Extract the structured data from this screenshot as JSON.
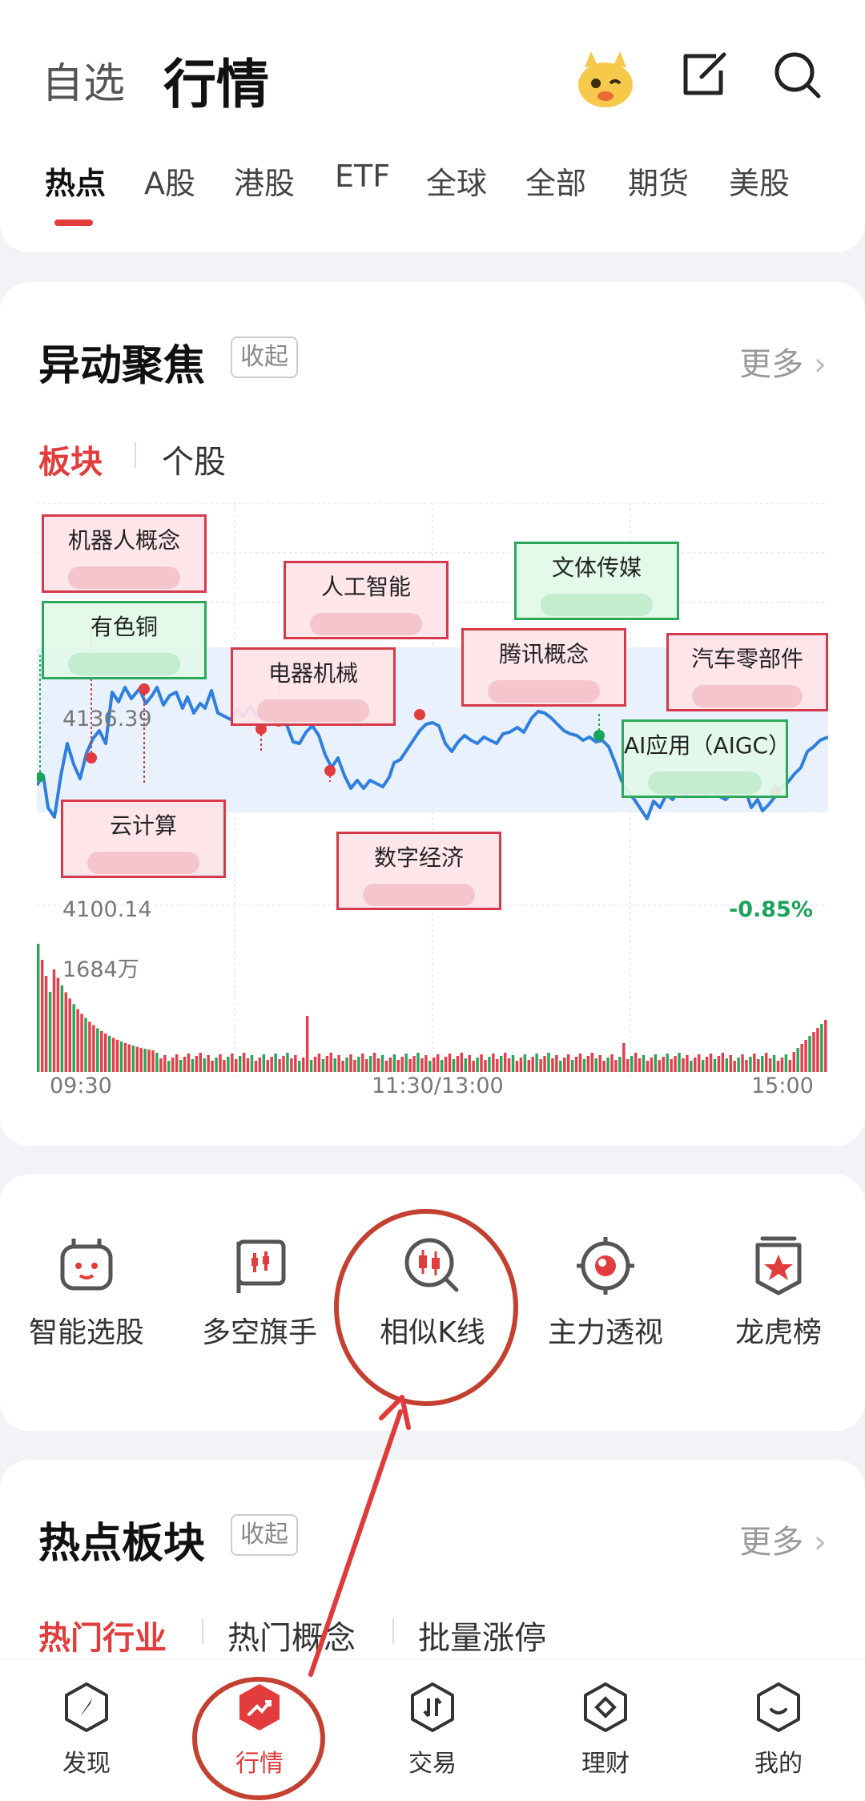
{
  "header": {
    "segment_inactive": "自选",
    "segment_active": "行情",
    "icons": [
      "mascot-icon",
      "edit-icon",
      "search-icon"
    ]
  },
  "tabs": [
    {
      "label": "热点"
    },
    {
      "label": "A股"
    },
    {
      "label": "港股"
    },
    {
      "label": "ETF"
    },
    {
      "label": "全球"
    },
    {
      "label": "全部"
    },
    {
      "label": "期货"
    },
    {
      "label": "美股"
    }
  ],
  "focus": {
    "title": "异动聚焦",
    "collapse": "收起",
    "more": "更多",
    "subtabs": [
      "板块",
      "个股"
    ],
    "price_high": "4136.39",
    "price_low": "4100.14",
    "pct": "-0.85%",
    "volume_max": "1684万",
    "times": [
      "09:30",
      "11:30/13:00",
      "15:00"
    ],
    "annotations": [
      {
        "label": "机器人概念"
      },
      {
        "label": "有色铜"
      },
      {
        "label": "云计算"
      },
      {
        "label": "人工智能"
      },
      {
        "label": "电器机械"
      },
      {
        "label": "数字经济"
      },
      {
        "label": "文体传媒"
      },
      {
        "label": "腾讯概念"
      },
      {
        "label": "汽车零部件"
      },
      {
        "label": "AI应用（AIGC）"
      }
    ]
  },
  "tools": [
    {
      "label": "智能选股",
      "icon": "robot-icon"
    },
    {
      "label": "多空旗手",
      "icon": "flag-chart-icon"
    },
    {
      "label": "相似K线",
      "icon": "candlestick-search-icon"
    },
    {
      "label": "主力透视",
      "icon": "target-icon"
    },
    {
      "label": "龙虎榜",
      "icon": "badge-star-icon"
    }
  ],
  "hot": {
    "title": "热点板块",
    "collapse": "收起",
    "more": "更多",
    "subtabs": [
      "热门行业",
      "热门概念",
      "批量涨停"
    ]
  },
  "nav": [
    {
      "label": "发现",
      "icon": "compass-icon"
    },
    {
      "label": "行情",
      "icon": "trend-icon"
    },
    {
      "label": "交易",
      "icon": "exchange-icon"
    },
    {
      "label": "理财",
      "icon": "diamond-icon"
    },
    {
      "label": "我的",
      "icon": "profile-icon"
    }
  ],
  "colors": {
    "accent_red": "#e23c3c",
    "line_blue": "#2f7fe0",
    "green": "#1aa35a",
    "annotation_red": "#d63a4a"
  }
}
